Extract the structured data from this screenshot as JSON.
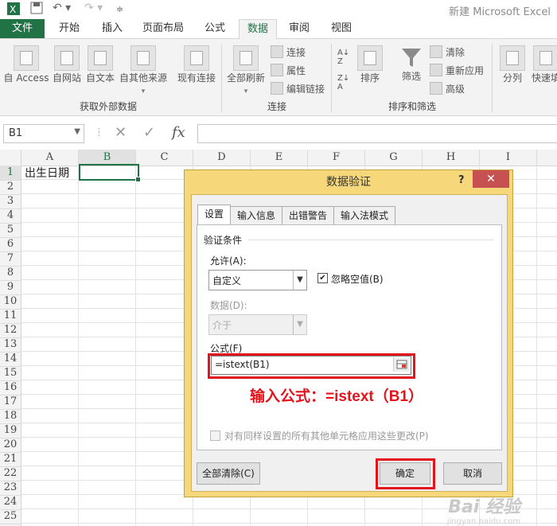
{
  "window": {
    "title": "新建 Microsoft Excel"
  },
  "tabs": [
    "文件",
    "开始",
    "插入",
    "页面布局",
    "公式",
    "数据",
    "审阅",
    "视图"
  ],
  "ribbon": {
    "get_external": {
      "buttons": [
        "自 Access",
        "自网站",
        "自文本",
        "自其他来源",
        "现有连接"
      ],
      "group": "获取外部数据"
    },
    "connections": {
      "big": "全部刷新",
      "items": [
        "连接",
        "属性",
        "编辑链接"
      ],
      "group": "连接"
    },
    "sort_filter": {
      "sort": "排序",
      "filter": "筛选",
      "items": [
        "清除",
        "重新应用",
        "高级"
      ],
      "group": "排序和筛选"
    },
    "tools": {
      "buttons": [
        "分列",
        "快速填"
      ]
    }
  },
  "formula_bar": {
    "name_box": "B1",
    "fx": "fx"
  },
  "grid": {
    "columns": [
      "A",
      "B",
      "C",
      "D",
      "E",
      "F",
      "G",
      "H",
      "I"
    ],
    "rows": [
      "1",
      "2",
      "3",
      "4",
      "5",
      "6",
      "7",
      "8",
      "9",
      "10",
      "11",
      "12",
      "13",
      "14",
      "15",
      "16",
      "17",
      "18",
      "19",
      "20",
      "21",
      "22",
      "23",
      "24",
      "25"
    ],
    "a1": "出生日期"
  },
  "dialog": {
    "title": "数据验证",
    "help": "?",
    "close": "✕",
    "tabs": [
      "设置",
      "输入信息",
      "出错警告",
      "输入法模式"
    ],
    "section": "验证条件",
    "allow_label": "允许(A):",
    "allow_value": "自定义",
    "ignore_blank": "忽略空值(B)",
    "data_label": "数据(D):",
    "data_value": "介于",
    "formula_label": "公式(F)",
    "formula_value": "=istext(B1)",
    "apply_all": "对有同样设置的所有其他单元格应用这些更改(P)",
    "clear_all": "全部清除(C)",
    "ok": "确定",
    "cancel": "取消"
  },
  "annotation": "输入公式：=istext（B1）",
  "watermark": {
    "main": "Bai 经验",
    "sub": "jingyan.baidu.com"
  }
}
